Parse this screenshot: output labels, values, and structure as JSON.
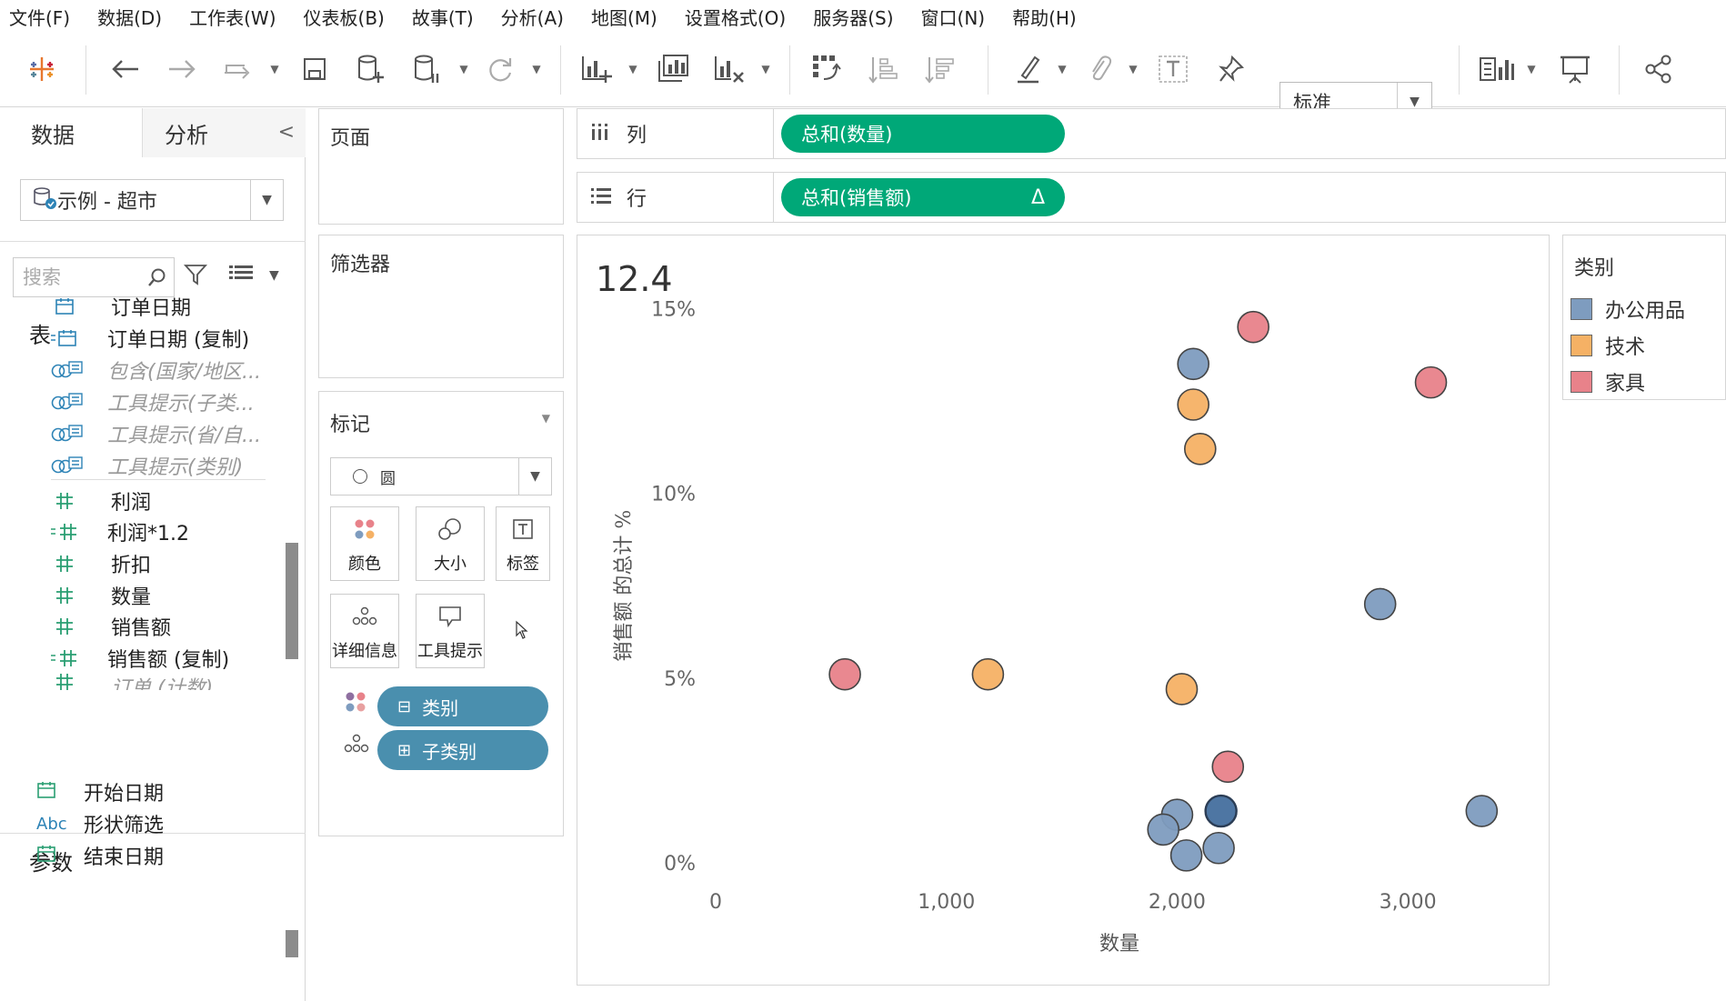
{
  "menu": [
    "文件(F)",
    "数据(D)",
    "工作表(W)",
    "仪表板(B)",
    "故事(T)",
    "分析(A)",
    "地图(M)",
    "设置格式(O)",
    "服务器(S)",
    "窗口(N)",
    "帮助(H)"
  ],
  "toolbar": {
    "view_select": "标准",
    "icons": [
      "tableau-logo-icon",
      "back-icon",
      "forward-icon",
      "redo-icon",
      "save-icon",
      "new-datasource-icon",
      "pause-datasource-icon",
      "refresh-icon",
      "new-worksheet-icon",
      "duplicate-worksheet-icon",
      "clear-worksheet-icon",
      "swap-icon",
      "sort-ascending-icon",
      "sort-descending-icon",
      "highlight-icon",
      "group-icon",
      "text-label-icon",
      "pin-icon",
      "show-me-icon",
      "presentation-icon",
      "share-icon"
    ]
  },
  "data_pane": {
    "tab_data": "数据",
    "tab_analysis": "分析",
    "datasource": "示例 - 超市",
    "search_placeholder": "搜索",
    "tables_title": "表",
    "fields": [
      {
        "name": "订单日期",
        "type": "date"
      },
      {
        "name": "订单日期 (复制)",
        "type": "date-calc"
      },
      {
        "name": "包含(国家/地区...",
        "type": "set",
        "italic": true
      },
      {
        "name": "工具提示(子类...",
        "type": "set",
        "italic": true
      },
      {
        "name": "工具提示(省/自...",
        "type": "set",
        "italic": true
      },
      {
        "name": "工具提示(类别)",
        "type": "set",
        "italic": true
      },
      {
        "name": "利润",
        "type": "measure"
      },
      {
        "name": "利润*1.2",
        "type": "measure-calc"
      },
      {
        "name": "折扣",
        "type": "measure"
      },
      {
        "name": "数量",
        "type": "measure"
      },
      {
        "name": "销售额",
        "type": "measure"
      },
      {
        "name": "销售额 (复制)",
        "type": "measure-calc"
      },
      {
        "name": "订单 (计数)",
        "type": "measure",
        "italic": true
      }
    ],
    "params_title": "参数",
    "params": [
      {
        "name": "开始日期",
        "type": "date"
      },
      {
        "name": "形状筛选",
        "type": "string",
        "badge": "Abc"
      },
      {
        "name": "结束日期",
        "type": "date"
      }
    ]
  },
  "cards": {
    "pages_title": "页面",
    "filters_title": "筛选器",
    "marks_title": "标记",
    "mark_type": "圆",
    "buttons": {
      "color": "颜色",
      "size": "大小",
      "label": "标签",
      "detail": "详细信息",
      "tooltip": "工具提示"
    },
    "pills": [
      {
        "label": "类别",
        "kind": "color"
      },
      {
        "label": "子类别",
        "kind": "detail"
      }
    ]
  },
  "shelves": {
    "columns_label": "列",
    "columns_pill": "总和(数量)",
    "rows_label": "行",
    "rows_pill": "总和(销售额)",
    "rows_pill_badge": "Δ"
  },
  "viz": {
    "title": "12.4"
  },
  "legend": {
    "title": "类别",
    "items": [
      {
        "name": "办公用品",
        "color": "#7e9cbf"
      },
      {
        "name": "技术",
        "color": "#f5b165"
      },
      {
        "name": "家具",
        "color": "#e8828a"
      }
    ]
  },
  "chart_data": {
    "type": "scatter",
    "xlabel": "数量",
    "ylabel": "销售额 的总计 %",
    "xlim": [
      0,
      3500
    ],
    "ylim": [
      0,
      0.155
    ],
    "x_ticks": [
      "0",
      "1,000",
      "2,000",
      "3,000"
    ],
    "x_tick_values": [
      0,
      1000,
      2000,
      3000
    ],
    "y_ticks": [
      "0%",
      "5%",
      "10%",
      "15%"
    ],
    "y_tick_values": [
      0,
      0.05,
      0.1,
      0.15
    ],
    "series": [
      {
        "name": "办公用品",
        "color": "#7e9cbf",
        "points": [
          {
            "x": 2070,
            "y": 0.135
          },
          {
            "x": 2880,
            "y": 0.07
          },
          {
            "x": 3320,
            "y": 0.014
          },
          {
            "x": 2000,
            "y": 0.013
          },
          {
            "x": 2190,
            "y": 0.014
          },
          {
            "x": 1940,
            "y": 0.009
          },
          {
            "x": 2180,
            "y": 0.004
          },
          {
            "x": 2040,
            "y": 0.002
          }
        ]
      },
      {
        "name": "技术",
        "color": "#f5b165",
        "points": [
          {
            "x": 2070,
            "y": 0.124
          },
          {
            "x": 2100,
            "y": 0.112
          },
          {
            "x": 1180,
            "y": 0.051
          },
          {
            "x": 2020,
            "y": 0.047
          }
        ]
      },
      {
        "name": "家具",
        "color": "#e8828a",
        "points": [
          {
            "x": 2330,
            "y": 0.145
          },
          {
            "x": 3100,
            "y": 0.13
          },
          {
            "x": 560,
            "y": 0.051
          },
          {
            "x": 2220,
            "y": 0.026
          }
        ]
      }
    ],
    "highlight_point": {
      "x": 2190,
      "y": 0.014,
      "color": "#4e76a3"
    }
  }
}
